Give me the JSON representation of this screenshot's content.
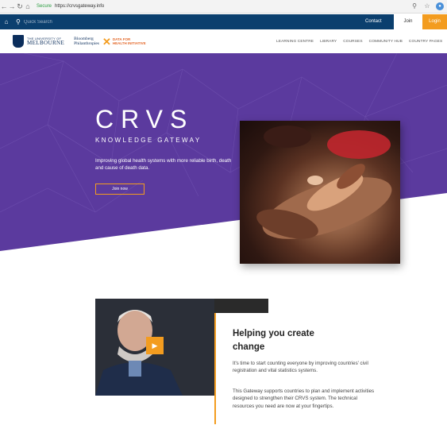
{
  "browser": {
    "url": "https://crvsgateway.info",
    "secure_label": "Secure"
  },
  "topbar": {
    "search_placeholder": "Quick Search",
    "contact": "Contact",
    "join": "Join",
    "login": "Login"
  },
  "logos": {
    "uom_small": "THE UNIVERSITY OF",
    "uom_big": "MELBOURNE",
    "bloomberg_line1": "Bloomberg",
    "bloomberg_line2": "Philanthropies",
    "d4h_line1": "DATA FOR",
    "d4h_line2": "HEALTH INITIATIVE"
  },
  "nav": {
    "items": [
      "LEARNING CENTRE",
      "LIBRARY",
      "COURSES",
      "COMMUNITY HUB",
      "COUNTRY PAGES"
    ]
  },
  "hero": {
    "title": "CRVS",
    "subtitle": "KNOWLEDGE GATEWAY",
    "description": "Improving global health systems with more reliable birth, death and cause of death data.",
    "cta": "Join now"
  },
  "section": {
    "title": "Helping you create change",
    "paragraph1": "It's time to start counting everyone by improving countries' civil registration and vital statistics systems.",
    "paragraph2": "This Gateway supports countries to plan and implement activities designed to strengthen their CRVS system. The technical resources you need are now at your fingertips."
  },
  "colors": {
    "purple": "#5b3a9e",
    "navy": "#0b3f6e",
    "orange": "#f39c1f"
  }
}
